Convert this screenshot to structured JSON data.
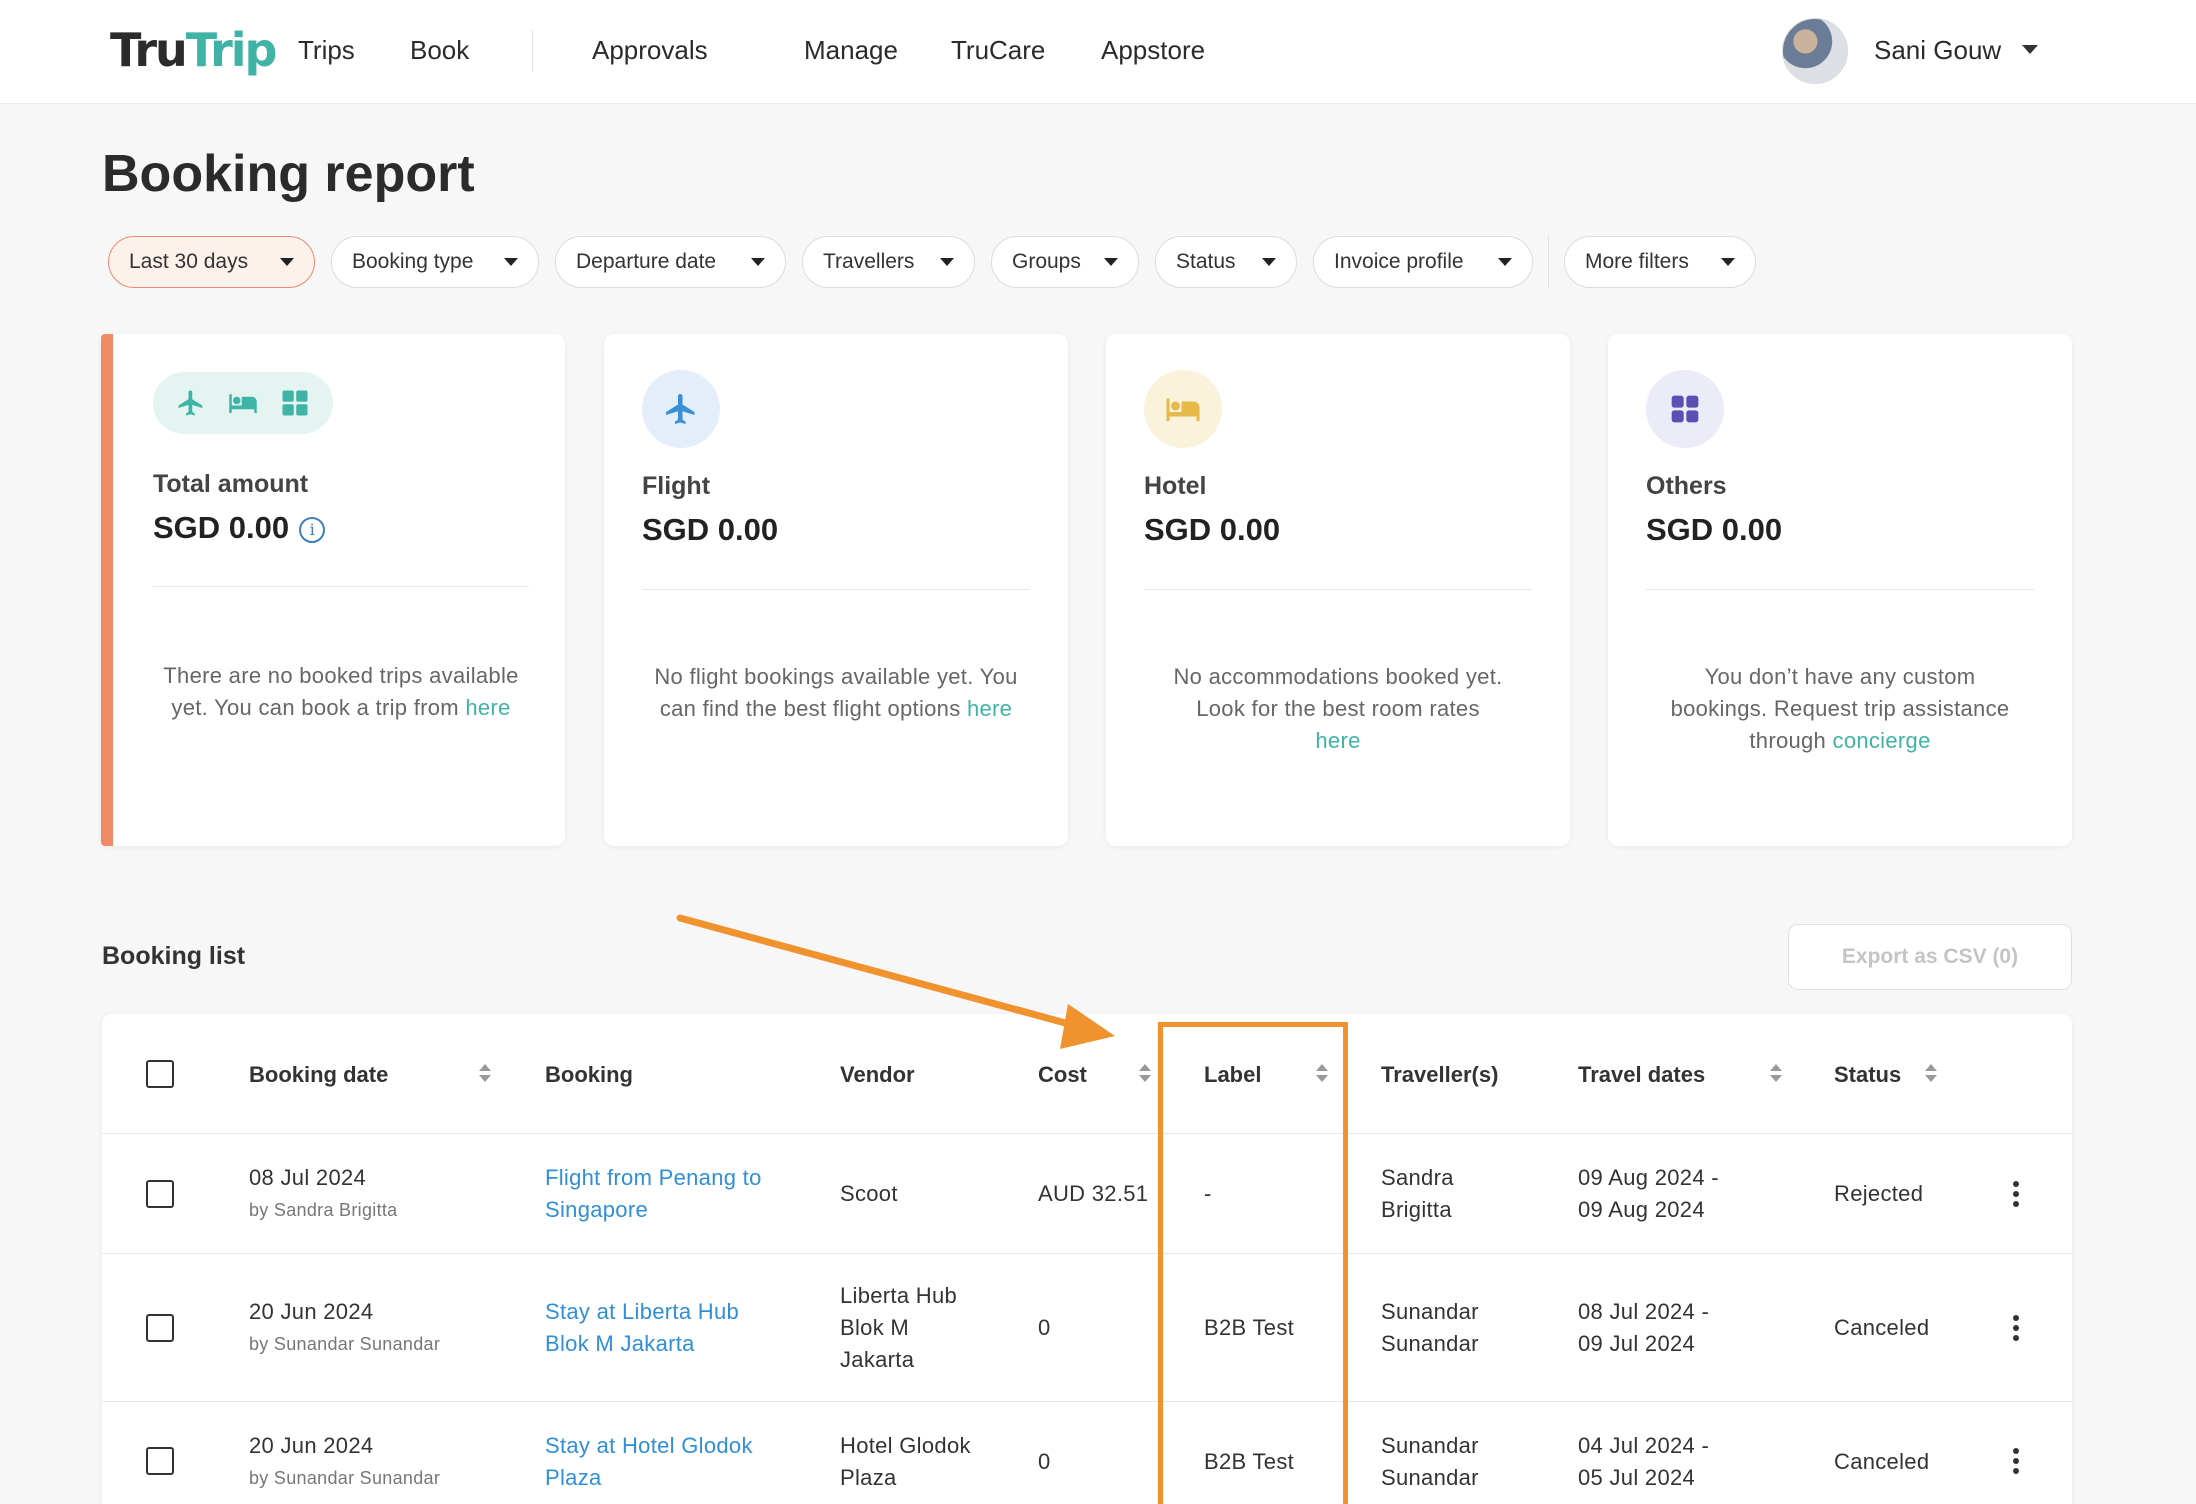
{
  "header": {
    "logo_part1": "Tru",
    "logo_part2": "Trip",
    "nav": [
      "Trips",
      "Book",
      "Approvals",
      "Manage",
      "TruCare",
      "Appstore"
    ],
    "user_name": "Sani Gouw"
  },
  "page": {
    "title": "Booking report"
  },
  "filters": [
    {
      "label": "Last 30 days",
      "active": true
    },
    {
      "label": "Booking type"
    },
    {
      "label": "Departure date"
    },
    {
      "label": "Travellers"
    },
    {
      "label": "Groups"
    },
    {
      "label": "Status"
    },
    {
      "label": "Invoice profile"
    },
    {
      "label": "More filters"
    }
  ],
  "cards": {
    "total": {
      "label": "Total amount",
      "amount": "SGD 0.00",
      "msg": "There are no booked trips available yet. You can book a trip from",
      "link": "here"
    },
    "flight": {
      "label": "Flight",
      "amount": "SGD 0.00",
      "msg": "No flight bookings available yet. You can find the best flight options",
      "link": "here"
    },
    "hotel": {
      "label": "Hotel",
      "amount": "SGD 0.00",
      "msg": "No accommodations booked yet. Look for the best room rates",
      "link": "here"
    },
    "others": {
      "label": "Others",
      "amount": "SGD 0.00",
      "msg": "You don’t have any custom bookings. Request trip assistance through",
      "link": "concierge"
    }
  },
  "booking_list": {
    "title": "Booking list",
    "export_label": "Export as CSV (0)",
    "columns": [
      "Booking date",
      "Booking",
      "Vendor",
      "Cost",
      "Label",
      "Traveller(s)",
      "Travel dates",
      "Status"
    ],
    "rows": [
      {
        "date": "08 Jul 2024",
        "by": "by Sandra Brigitta",
        "booking_l1": "Flight from Penang to",
        "booking_l2": "Singapore",
        "vendor_l1": "Scoot",
        "vendor_l2": "",
        "vendor_l3": "",
        "cost": "AUD 32.51",
        "label": "-",
        "traveller_l1": "Sandra",
        "traveller_l2": "Brigitta",
        "dates_l1": "09 Aug 2024 -",
        "dates_l2": "09 Aug 2024",
        "status": "Rejected"
      },
      {
        "date": "20 Jun 2024",
        "by": "by Sunandar Sunandar",
        "booking_l1": "Stay at Liberta Hub",
        "booking_l2": "Blok M Jakarta",
        "vendor_l1": "Liberta Hub",
        "vendor_l2": "Blok M",
        "vendor_l3": "Jakarta",
        "cost": "0",
        "label": "B2B Test",
        "traveller_l1": "Sunandar",
        "traveller_l2": "Sunandar",
        "dates_l1": "08 Jul 2024 -",
        "dates_l2": "09 Jul 2024",
        "status": "Canceled"
      },
      {
        "date": "20 Jun 2024",
        "by": "by Sunandar Sunandar",
        "booking_l1": "Stay at Hotel Glodok",
        "booking_l2": "Plaza",
        "vendor_l1": "Hotel Glodok",
        "vendor_l2": "Plaza",
        "vendor_l3": "",
        "cost": "0",
        "label": "B2B Test",
        "traveller_l1": "Sunandar",
        "traveller_l2": "Sunandar",
        "dates_l1": "04 Jul 2024 -",
        "dates_l2": "05 Jul 2024",
        "status": "Canceled"
      }
    ]
  },
  "colors": {
    "brand_teal": "#3fb3a5",
    "link_blue": "#2f8fd8",
    "accent_orange": "#ee8a66",
    "annotation_orange": "#f0922e"
  },
  "icons": [
    "plane-icon",
    "bed-icon",
    "grid-icon",
    "info-icon",
    "caret-down-icon",
    "sort-icon",
    "kebab-icon"
  ]
}
